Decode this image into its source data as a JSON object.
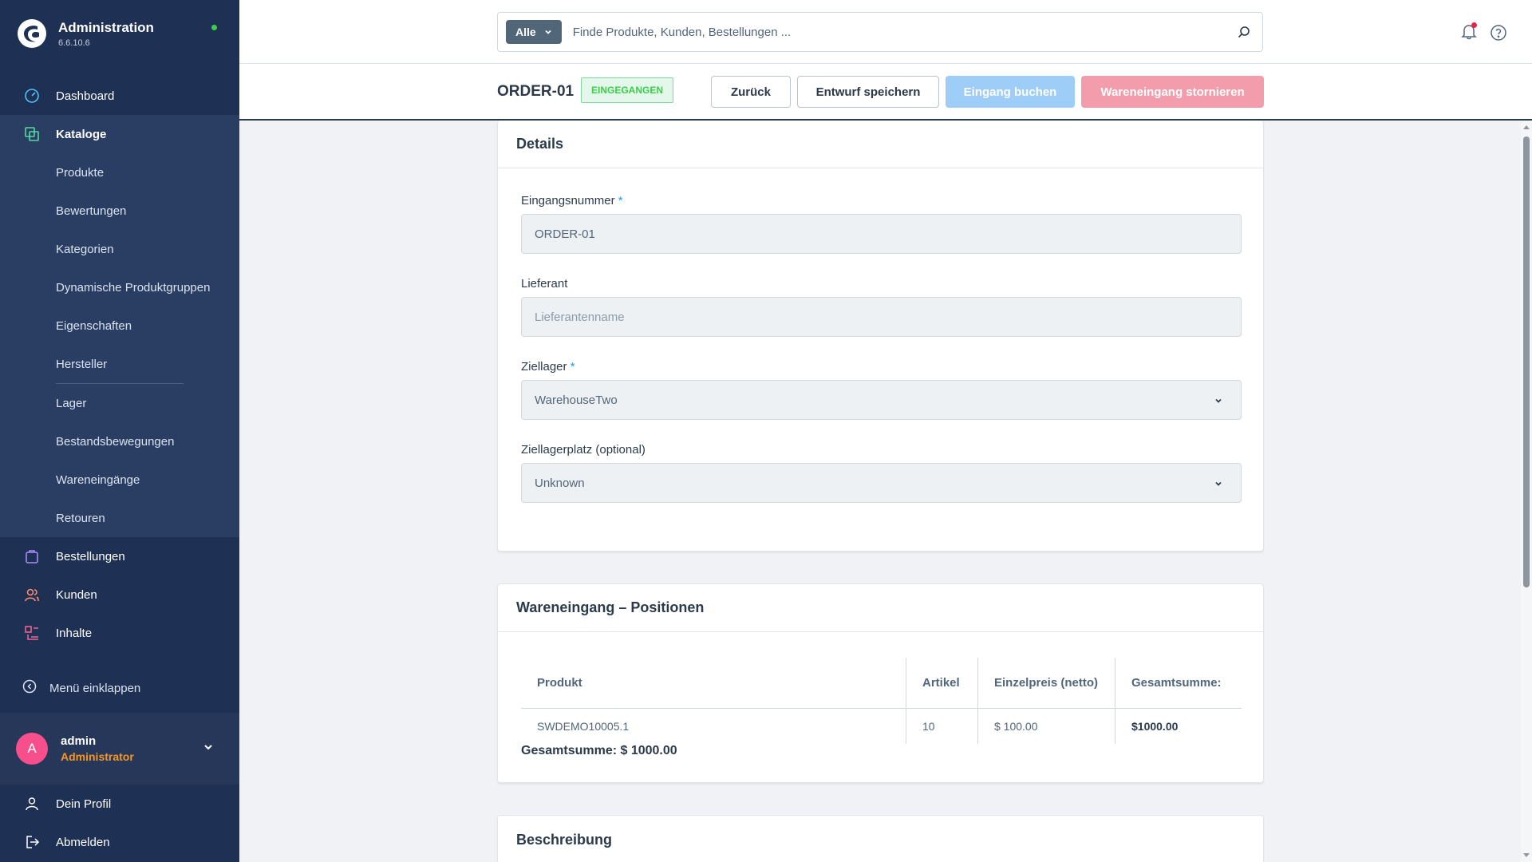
{
  "brand": {
    "title": "Administration",
    "version": "6.6.10.6"
  },
  "sidebar": {
    "main_items": [
      {
        "label": "Dashboard",
        "icon": "dashboard-icon"
      },
      {
        "label": "Kataloge",
        "icon": "catalog-icon"
      }
    ],
    "sub_items": [
      "Produkte",
      "Bewertungen",
      "Kategorien",
      "Dynamische Produktgruppen",
      "Eigenschaften",
      "Hersteller",
      "Lager",
      "Bestandsbewegungen",
      "Wareneingänge",
      "Retouren"
    ],
    "lower_items": [
      {
        "label": "Bestellungen",
        "icon": "bag-icon"
      },
      {
        "label": "Kunden",
        "icon": "users-icon"
      },
      {
        "label": "Inhalte",
        "icon": "content-icon"
      }
    ],
    "collapse_label": "Menü einklappen",
    "user": {
      "initial": "A",
      "name": "admin",
      "role": "Administrator"
    },
    "bottom_items": [
      {
        "label": "Dein Profil",
        "icon": "user-icon"
      },
      {
        "label": "Abmelden",
        "icon": "logout-icon"
      }
    ]
  },
  "search": {
    "scope": "Alle",
    "placeholder": "Finde Produkte, Kunden, Bestellungen ..."
  },
  "smartbar": {
    "title": "ORDER-01",
    "status": "EINGEGANGEN",
    "buttons": {
      "back": "Zurück",
      "draft": "Entwurf speichern",
      "book": "Eingang buchen",
      "cancel": "Wareneingang stornieren"
    }
  },
  "details": {
    "header": "Details",
    "receipt_number": {
      "label": "Eingangsnummer",
      "required": "*",
      "value": "ORDER-01"
    },
    "supplier": {
      "label": "Lieferant",
      "placeholder": "Lieferantenname"
    },
    "target_warehouse": {
      "label": "Ziellager",
      "required": "*",
      "value": "WarehouseTwo"
    },
    "target_bin": {
      "label": "Ziellagerplatz (optional)",
      "value": "Unknown"
    }
  },
  "positions": {
    "header": "Wareneingang – Positionen",
    "columns": [
      "Produkt",
      "Artikel",
      "Einzelpreis (netto)",
      "Gesamtsumme:"
    ],
    "rows": [
      {
        "product": "SWDEMO10005.1",
        "qty": "10",
        "unit_price": "$ 100.00",
        "total": "$1000.00"
      }
    ],
    "grand_total": "Gesamtsumme: $ 1000.00"
  },
  "description": {
    "header": "Beschreibung"
  },
  "colors": {
    "sidebar_bg": "#1e3054",
    "status_green": "#37d046",
    "accent_blue": "#189eff",
    "danger_pink": "#f29cac",
    "role_orange": "#f8961e"
  }
}
